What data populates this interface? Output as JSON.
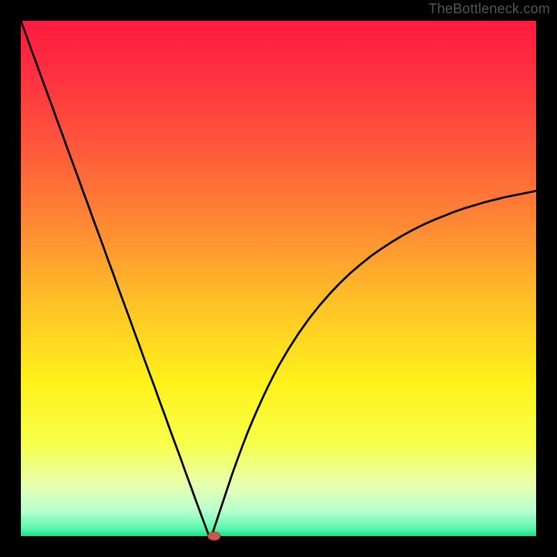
{
  "watermark": "TheBottleneck.com",
  "colors": {
    "background_frame": "#000000",
    "gradient_stops": [
      {
        "offset": 0.0,
        "color": "#ff1a3f"
      },
      {
        "offset": 0.1,
        "color": "#ff3040"
      },
      {
        "offset": 0.25,
        "color": "#ff593c"
      },
      {
        "offset": 0.4,
        "color": "#ff8a33"
      },
      {
        "offset": 0.55,
        "color": "#ffc227"
      },
      {
        "offset": 0.7,
        "color": "#fff11a"
      },
      {
        "offset": 0.82,
        "color": "#f7ff4a"
      },
      {
        "offset": 0.9,
        "color": "#e8ffb0"
      },
      {
        "offset": 0.95,
        "color": "#b9ffce"
      },
      {
        "offset": 0.985,
        "color": "#5bf7b0"
      },
      {
        "offset": 1.0,
        "color": "#18e07d"
      }
    ],
    "curve_stroke": "#000000",
    "marker_fill": "#c95a4a",
    "marker_stroke": "#9a3f33"
  },
  "layout": {
    "plot_margin": 30,
    "plot_size": 740,
    "curve_width": 3,
    "marker_rx": 9,
    "marker_ry": 6
  },
  "chart_data": {
    "type": "line",
    "title": "",
    "xlabel": "",
    "ylabel": "",
    "xlim": [
      0,
      100
    ],
    "ylim": [
      0,
      100
    ],
    "grid": false,
    "legend": false,
    "series": [
      {
        "name": "bottleneck-curve",
        "x": [
          0,
          1,
          2,
          3,
          4,
          5,
          6,
          7,
          8,
          9,
          10,
          11,
          12,
          13,
          14,
          15,
          16,
          17,
          18,
          19,
          20,
          21,
          22,
          23,
          24,
          25,
          26,
          27,
          28,
          29,
          30,
          31,
          32,
          33,
          34,
          35,
          36,
          36.5,
          37,
          38,
          39,
          40,
          41,
          42,
          43,
          44,
          45,
          46,
          47,
          48,
          49,
          50,
          52,
          54,
          56,
          58,
          60,
          62,
          64,
          66,
          68,
          70,
          72,
          74,
          76,
          78,
          80,
          82,
          84,
          86,
          88,
          90,
          92,
          94,
          96,
          98,
          100
        ],
        "y": [
          100,
          97.3,
          94.5,
          91.8,
          89.0,
          86.3,
          83.6,
          80.8,
          78.1,
          75.3,
          72.6,
          69.9,
          67.1,
          64.4,
          61.6,
          58.9,
          56.2,
          53.4,
          50.7,
          47.9,
          45.2,
          42.5,
          39.7,
          37.0,
          34.2,
          31.5,
          28.8,
          26.0,
          23.3,
          20.5,
          17.8,
          15.1,
          12.3,
          9.6,
          6.8,
          4.1,
          1.4,
          0.0,
          0.0,
          3.0,
          6.0,
          9.0,
          12.0,
          14.8,
          17.5,
          20.1,
          22.5,
          24.8,
          27.0,
          29.1,
          31.1,
          33.0,
          36.4,
          39.5,
          42.3,
          44.8,
          47.1,
          49.2,
          51.1,
          52.8,
          54.4,
          55.8,
          57.1,
          58.3,
          59.4,
          60.4,
          61.3,
          62.1,
          62.9,
          63.6,
          64.2,
          64.8,
          65.3,
          65.8,
          66.2,
          66.6,
          67.0
        ]
      }
    ],
    "marker": {
      "x": 37.5,
      "y": 0
    },
    "annotations": []
  }
}
